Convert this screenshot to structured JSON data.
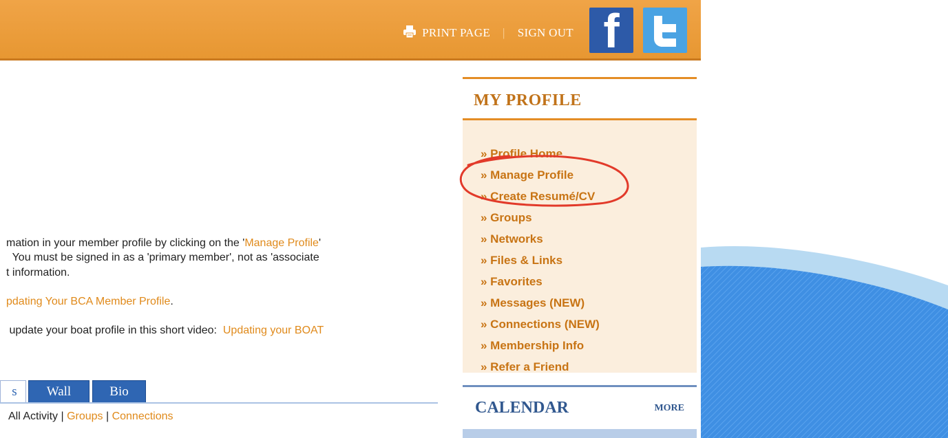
{
  "header": {
    "print_label": "PRINT PAGE",
    "signout_label": "SIGN OUT",
    "facebook_label": "f"
  },
  "content": {
    "para_line1_a": "mation in your member profile by clicking on the '",
    "para_line1_link": "Manage Profile",
    "para_line1_b": "'",
    "para_line2": "  You must be signed in as a 'primary member', not as 'associate",
    "para_line3": "t information.",
    "link_updating_profile": "pdating Your BCA Member Profile",
    "link_updating_profile_suffix": ".",
    "boat_line_prefix": " update your boat profile in this short video:  ",
    "boat_line_link": "Updating your BOAT",
    "tabs": {
      "first": "s",
      "wall": "Wall",
      "bio": "Bio"
    },
    "activity": {
      "all": "All Activity",
      "groups": "Groups",
      "connections": "Connections",
      "sep": " | "
    }
  },
  "sidebar": {
    "title": "MY PROFILE",
    "items": [
      "» Profile Home",
      "» Manage Profile",
      "» Create Resumé/CV",
      "» Groups",
      "» Networks",
      "» Files & Links",
      "» Favorites",
      "» Messages (NEW)",
      "» Connections (NEW)",
      "» Membership Info",
      "» Refer a Friend"
    ]
  },
  "calendar": {
    "title": "CALENDAR",
    "more": "MORE"
  },
  "colors": {
    "header_orange": "#e79732",
    "link_orange": "#e08a1b",
    "sidebar_bg": "#fbeedd",
    "tab_blue": "#2f66b3",
    "annotation_red": "#e23a2a",
    "facebook_blue": "#2d5aa8",
    "twitter_blue": "#4aa3e3"
  },
  "icons": {
    "print": "printer-icon",
    "facebook": "facebook-icon",
    "twitter": "twitter-icon"
  }
}
